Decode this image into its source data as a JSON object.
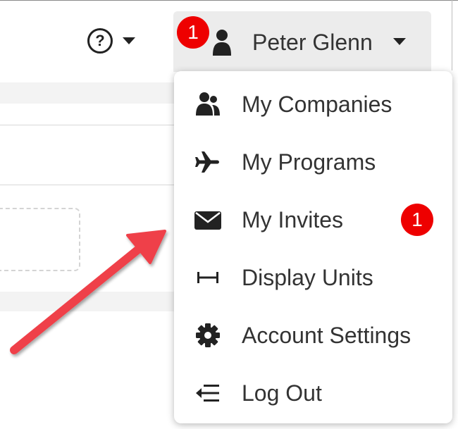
{
  "header": {
    "help_icon_glyph": "?",
    "user": {
      "name": "Peter Glenn",
      "notification_count": "1"
    }
  },
  "menu": {
    "items": [
      {
        "label": "My Companies",
        "icon": "users-icon"
      },
      {
        "label": "My Programs",
        "icon": "plane-icon"
      },
      {
        "label": "My Invites",
        "icon": "envelope-icon",
        "badge": "1"
      },
      {
        "label": "Display Units",
        "icon": "ruler-icon"
      },
      {
        "label": "Account Settings",
        "icon": "gear-icon"
      },
      {
        "label": "Log Out",
        "icon": "logout-icon"
      }
    ]
  },
  "colors": {
    "badge": "#ee0000",
    "arrow": "#ef4048",
    "header_button_bg": "#ececec",
    "text": "#333333"
  }
}
